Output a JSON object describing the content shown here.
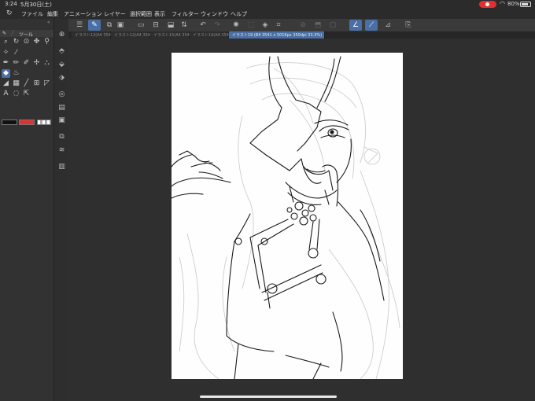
{
  "status": {
    "time": "3:24",
    "date": "5月30日(土)",
    "battery": "80%",
    "battery_level": 0.8
  },
  "menu": [
    "ファイル",
    "編集",
    "アニメーション",
    "レイヤー",
    "選択範囲",
    "表示",
    "フィルター",
    "ウィンドウ",
    "ヘルプ"
  ],
  "left_panel": {
    "title": "ツール"
  },
  "tabs": [
    {
      "label": "イラスト13(A4 3541 x...",
      "active": false
    },
    {
      "label": "イラスト12(A4 3541 x...",
      "active": false
    },
    {
      "label": "イラスト15(A4 3541 x...",
      "active": false
    },
    {
      "label": "イラスト16(A4 3541 x...",
      "active": false
    },
    {
      "label": "イラスト19 (B4 3541 x 5016px 350dpi 33.3%)",
      "active": true
    }
  ],
  "colors": {
    "main": "#111111",
    "sub": "#e03030",
    "accent": "#4a6fa5",
    "record": "#e03030"
  }
}
